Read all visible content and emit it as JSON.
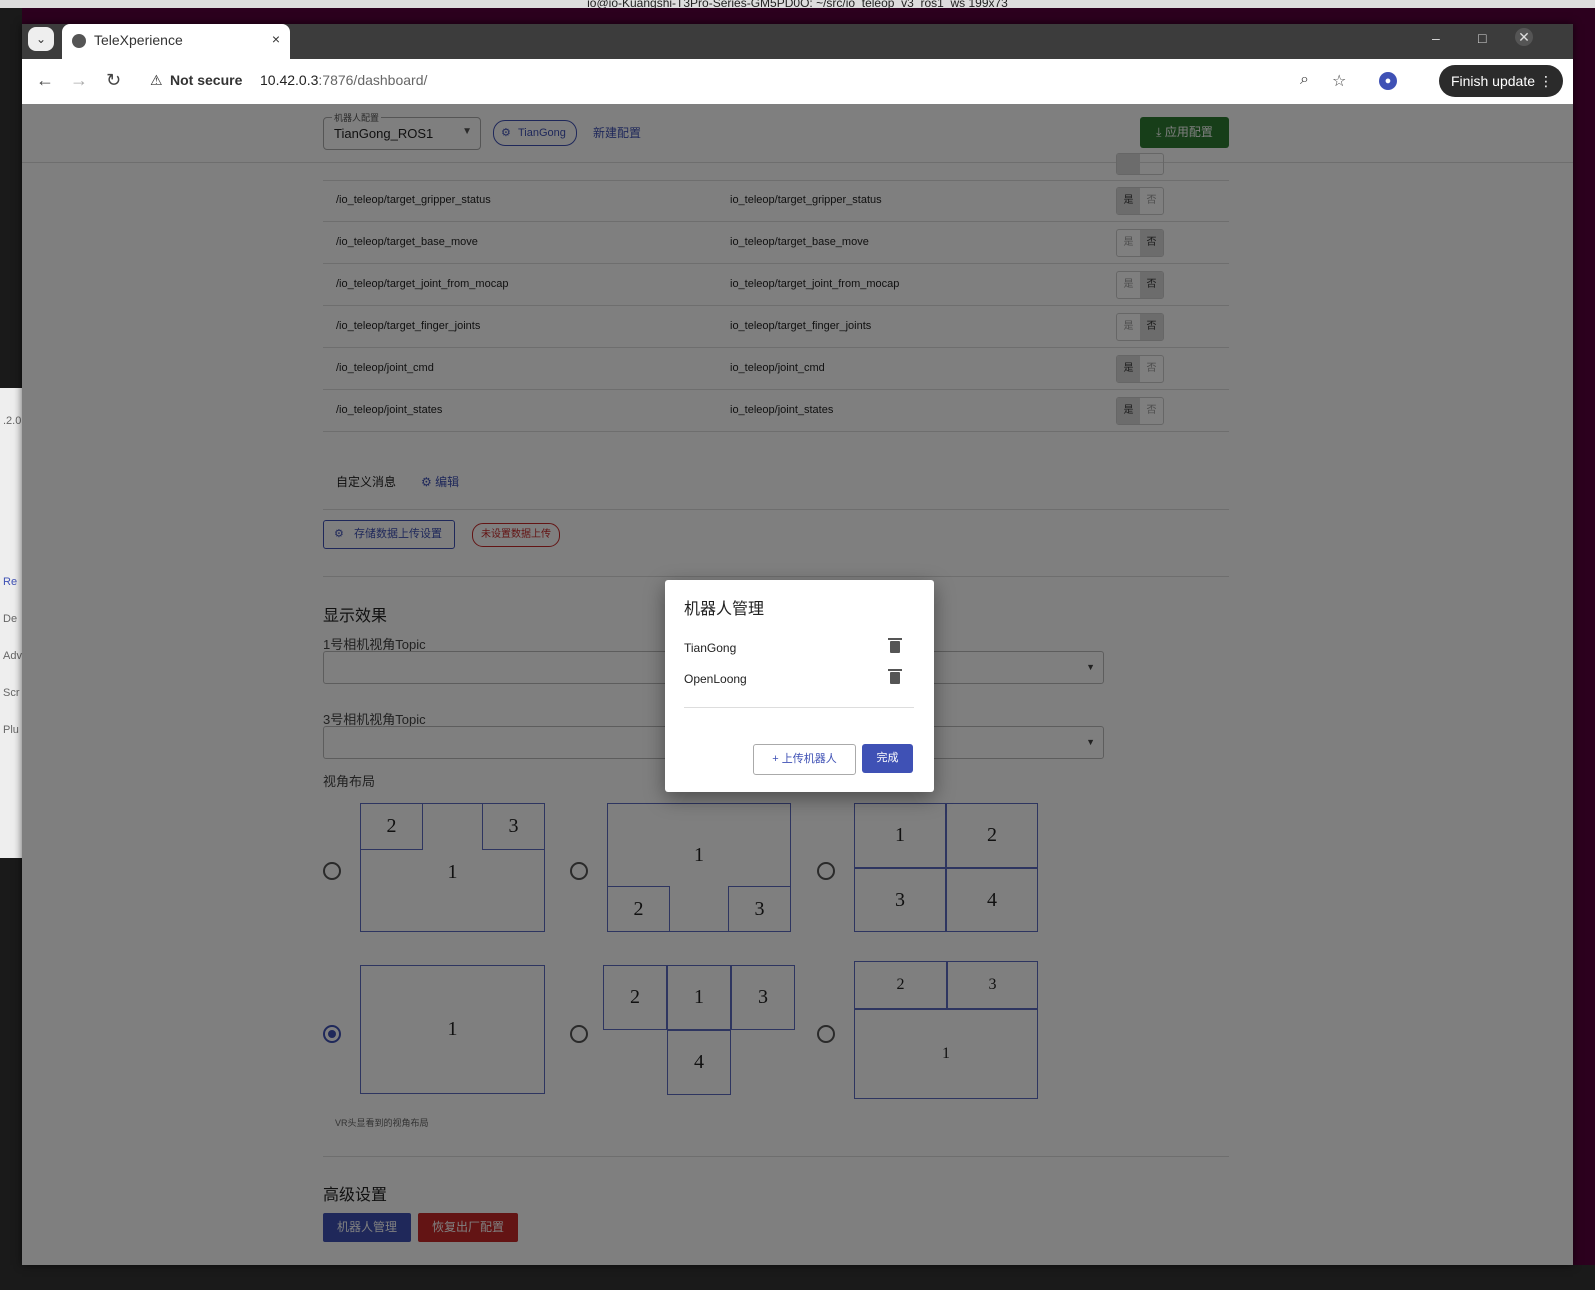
{
  "terminal": {
    "title": "io@io-Kuangshi-T3Pro-Series-GM5PD0O: ~/src/io_teleop_v3_ros1_ws 199x73",
    "side_labels": [
      "Re",
      "De",
      "Adv",
      "Scr",
      "Plu"
    ],
    "version_fragment": ".2.0"
  },
  "browser": {
    "tab_title": "TeleXperience",
    "close": "×",
    "not_secure": "Not secure",
    "url_host": "10.42.0.3",
    "url_rest": ":7876/dashboard/",
    "finish_update": "Finish update",
    "menu_dots": "⋮"
  },
  "topbar": {
    "robot_config_label": "机器人配置",
    "robot_config_value": "TianGong_ROS1",
    "robot_chip": "TianGong",
    "new_config": "新建配置",
    "apply_config": "应用配置"
  },
  "topics": [
    {
      "ros1": "/io_teleop/target_gripper_status",
      "ros2": "io_teleop/target_gripper_status",
      "yes": "是",
      "no": "否",
      "selected": "yes"
    },
    {
      "ros1": "/io_teleop/target_base_move",
      "ros2": "io_teleop/target_base_move",
      "yes": "是",
      "no": "否",
      "selected": "no"
    },
    {
      "ros1": "/io_teleop/target_joint_from_mocap",
      "ros2": "io_teleop/target_joint_from_mocap",
      "yes": "是",
      "no": "否",
      "selected": "no"
    },
    {
      "ros1": "/io_teleop/target_finger_joints",
      "ros2": "io_teleop/target_finger_joints",
      "yes": "是",
      "no": "否",
      "selected": "no"
    },
    {
      "ros1": "/io_teleop/joint_cmd",
      "ros2": "io_teleop/joint_cmd",
      "yes": "是",
      "no": "否",
      "selected": "yes"
    },
    {
      "ros1": "/io_teleop/joint_states",
      "ros2": "io_teleop/joint_states",
      "yes": "是",
      "no": "否",
      "selected": "yes"
    }
  ],
  "custom_msg": {
    "label": "自定义消息",
    "edit": "编辑"
  },
  "storage": {
    "button": "存储数据上传设置",
    "status": "未设置数据上传"
  },
  "display": {
    "title": "显示效果",
    "cam1_label": "1号相机视角Topic",
    "cam3_label": "3号相机视角Topic",
    "layout_label": "视角布局",
    "vr_note": "VR头显看到的视角布局",
    "selected_layout": 4,
    "cell_labels": {
      "one": "1",
      "two": "2",
      "three": "3",
      "four": "4"
    }
  },
  "advanced": {
    "title": "高级设置",
    "robot_mgmt": "机器人管理",
    "factory_reset": "恢复出厂配置"
  },
  "dialog": {
    "title": "机器人管理",
    "robots": [
      "TianGong",
      "OpenLoong"
    ],
    "upload": "上传机器人",
    "done": "完成"
  },
  "colors": {
    "primary": "#3f51b5",
    "apply_green": "#2e7d32",
    "danger": "#c62828"
  }
}
